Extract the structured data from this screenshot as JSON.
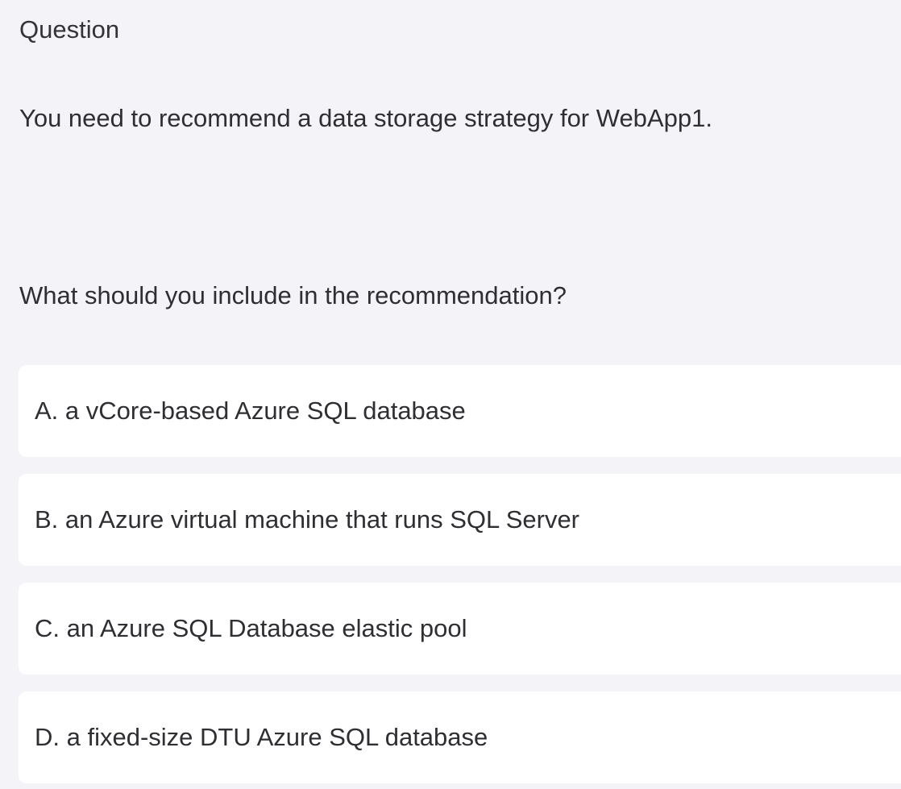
{
  "header": {
    "label": "Question"
  },
  "question": {
    "lines": [
      "You need to recommend a data storage strategy for WebApp1.",
      "What should you include in the recommendation?"
    ]
  },
  "options": [
    {
      "text": "A. a vCore-based Azure SQL database"
    },
    {
      "text": "B. an Azure virtual machine that runs SQL Server"
    },
    {
      "text": "C. an Azure SQL Database elastic pool"
    },
    {
      "text": "D. a fixed-size DTU Azure SQL database"
    }
  ]
}
